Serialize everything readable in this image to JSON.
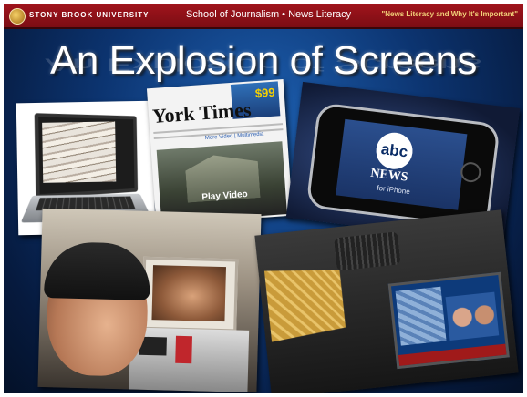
{
  "header": {
    "university": "STONY BROOK UNIVERSITY",
    "school": "School of Journalism • News Literacy",
    "course_quote": "\"News Literacy and Why It's Important\""
  },
  "title": "An Explosion of Screens",
  "photos": {
    "newspaper_site": {
      "logo": "York Times",
      "ad_price": "$99",
      "video_label": "Play Video",
      "link_text": "More Video | Multimedia"
    },
    "iphone_app": {
      "logo": "abc",
      "wordmark": "NEWS",
      "subtitle": "for iPhone"
    }
  },
  "colors": {
    "header_bar": "#8b0f17",
    "quote_text": "#f2d27a",
    "background": "#0c3470"
  }
}
